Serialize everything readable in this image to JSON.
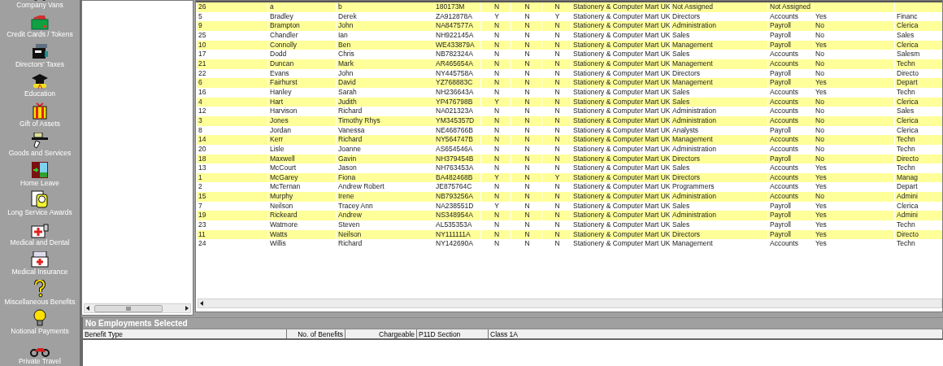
{
  "sidebar": {
    "items": [
      {
        "label": "Company Vans"
      },
      {
        "label": "Credit Cards / Tokens"
      },
      {
        "label": "Directors' Taxes"
      },
      {
        "label": "Education"
      },
      {
        "label": "Gift of Assets"
      },
      {
        "label": "Goods and Services"
      },
      {
        "label": "Home Leave"
      },
      {
        "label": "Long Service Awards"
      },
      {
        "label": "Medical and Dental"
      },
      {
        "label": "Medical Insurance"
      },
      {
        "label": "Miscellaneous Benefits"
      },
      {
        "label": "Notional Payments"
      },
      {
        "label": "Private Travel"
      }
    ]
  },
  "table": {
    "rows": [
      {
        "cells": [
          "26",
          "a",
          "b",
          "180173M",
          "N",
          "N",
          "N",
          "Stationery & Computer Mart UK",
          "Not Assigned",
          "Not Assigned",
          null,
          null
        ]
      },
      {
        "cells": [
          "5",
          "Bradley",
          "Derek",
          "ZA912878A",
          "Y",
          "N",
          "Y",
          "Stationery & Computer Mart UK",
          "Directors",
          "Accounts",
          "Yes",
          "Financ"
        ]
      },
      {
        "cells": [
          "9",
          "Brampton",
          "John",
          "NA847577A",
          "N",
          "N",
          "N",
          "Stationery & Computer Mart UK",
          "Administration",
          "Payroll",
          "No",
          "Clerica"
        ]
      },
      {
        "cells": [
          "25",
          "Chandler",
          "Ian",
          "NH922145A",
          "N",
          "N",
          "N",
          "Stationery & Computer Mart UK",
          "Sales",
          "Payroll",
          "No",
          "Sales"
        ]
      },
      {
        "cells": [
          "10",
          "Connolly",
          "Ben",
          "WE433879A",
          "N",
          "N",
          "N",
          "Stationery & Computer Mart UK",
          "Management",
          "Payroll",
          "Yes",
          "Clerica"
        ]
      },
      {
        "cells": [
          "17",
          "Dodd",
          "Chris",
          "NB782324A",
          "N",
          "N",
          "N",
          "Stationery & Computer Mart UK",
          "Sales",
          "Accounts",
          "No",
          "Salesm"
        ]
      },
      {
        "cells": [
          "21",
          "Duncan",
          "Mark",
          "AR465654A",
          "N",
          "N",
          "N",
          "Stationery & Computer Mart UK",
          "Management",
          "Accounts",
          "No",
          "Techn"
        ]
      },
      {
        "cells": [
          "22",
          "Evans",
          "John",
          "NY445758A",
          "N",
          "N",
          "N",
          "Stationery & Computer Mart UK",
          "Directors",
          "Payroll",
          "No",
          "Directo"
        ]
      },
      {
        "cells": [
          "6",
          "Fairhurst",
          "David",
          "YZ768883C",
          "N",
          "N",
          "N",
          "Stationery & Computer Mart UK",
          "Management",
          "Payroll",
          "Yes",
          "Depart"
        ]
      },
      {
        "cells": [
          "16",
          "Hanley",
          "Sarah",
          "NH236643A",
          "N",
          "N",
          "N",
          "Stationery & Computer Mart UK",
          "Sales",
          "Accounts",
          "Yes",
          "Techn"
        ]
      },
      {
        "cells": [
          "4",
          "Hart",
          "Judith",
          "YP476798B",
          "Y",
          "N",
          "N",
          "Stationery & Computer Mart UK",
          "Sales",
          "Accounts",
          "No",
          "Clerica"
        ]
      },
      {
        "cells": [
          "12",
          "Harvison",
          "Richard",
          "NA021323A",
          "N",
          "N",
          "N",
          "Stationery & Computer Mart UK",
          "Administration",
          "Accounts",
          "No",
          "Sales"
        ]
      },
      {
        "cells": [
          "3",
          "Jones",
          "Timothy Rhys",
          "YM345357D",
          "N",
          "N",
          "N",
          "Stationery & Computer Mart UK",
          "Administration",
          "Accounts",
          "No",
          "Clerica"
        ]
      },
      {
        "cells": [
          "8",
          "Jordan",
          "Vanessa",
          "NE468766B",
          "N",
          "N",
          "N",
          "Stationery & Computer Mart UK",
          "Analysts",
          "Payroll",
          "No",
          "Clerica"
        ]
      },
      {
        "cells": [
          "14",
          "Kerr",
          "Richard",
          "NY564747B",
          "N",
          "N",
          "N",
          "Stationery & Computer Mart UK",
          "Management",
          "Accounts",
          "No",
          "Techn"
        ]
      },
      {
        "cells": [
          "20",
          "Lisle",
          "Joanne",
          "AS654546A",
          "N",
          "N",
          "N",
          "Stationery & Computer Mart UK",
          "Administration",
          "Accounts",
          "No",
          "Techn"
        ]
      },
      {
        "cells": [
          "18",
          "Maxwell",
          "Gavin",
          "NH379454B",
          "N",
          "N",
          "N",
          "Stationery & Computer Mart UK",
          "Directors",
          "Payroll",
          "No",
          "Directo"
        ]
      },
      {
        "cells": [
          "13",
          "McCourt",
          "Jason",
          "NH763453A",
          "N",
          "N",
          "N",
          "Stationery & Computer Mart UK",
          "Sales",
          "Accounts",
          "Yes",
          "Techn"
        ]
      },
      {
        "cells": [
          "1",
          "McGarey",
          "Fiona",
          "BA482468B",
          "Y",
          "N",
          "Y",
          "Stationery & Computer Mart UK",
          "Directors",
          "Accounts",
          "Yes",
          "Manag"
        ]
      },
      {
        "cells": [
          "2",
          "McTernan",
          "Andrew Robert",
          "JE875764C",
          "N",
          "N",
          "N",
          "Stationery & Computer Mart UK",
          "Programmers",
          "Accounts",
          "Yes",
          "Depart"
        ]
      },
      {
        "cells": [
          "15",
          "Murphy",
          "Irene",
          "NB793256A",
          "N",
          "N",
          "N",
          "Stationery & Computer Mart UK",
          "Administration",
          "Accounts",
          "No",
          "Admini"
        ]
      },
      {
        "cells": [
          "7",
          "Neilson",
          "Tracey Ann",
          "NA238551D",
          "Y",
          "N",
          "N",
          "Stationery & Computer Mart UK",
          "Sales",
          "Payroll",
          "Yes",
          "Clerica"
        ]
      },
      {
        "cells": [
          "19",
          "Rickeard",
          "Andrew",
          "NS348954A",
          "N",
          "N",
          "N",
          "Stationery & Computer Mart UK",
          "Administration",
          "Payroll",
          "Yes",
          "Admini"
        ]
      },
      {
        "cells": [
          "23",
          "Watmore",
          "Steven",
          "AL535353A",
          "N",
          "N",
          "N",
          "Stationery & Computer Mart UK",
          "Sales",
          "Payroll",
          "Yes",
          "Techn"
        ]
      },
      {
        "cells": [
          "11",
          "Watts",
          "Neilson",
          "NY111111A",
          "N",
          "N",
          "N",
          "Stationery & Computer Mart UK",
          "Directors",
          "Payroll",
          "Yes",
          "Directo"
        ]
      },
      {
        "cells": [
          "24",
          "Willis",
          "Richard",
          "NY142690A",
          "N",
          "N",
          "N",
          "Stationery & Computer Mart UK",
          "Management",
          "Accounts",
          "Yes",
          "Techn"
        ]
      }
    ]
  },
  "benefits_panel": {
    "title": "No Employments Selected",
    "columns": [
      {
        "label": "Benefit Type"
      },
      {
        "label": "No. of Benefits"
      },
      {
        "label": "Chargeable"
      },
      {
        "label": "P11D Section"
      },
      {
        "label": "Class 1A"
      }
    ]
  }
}
